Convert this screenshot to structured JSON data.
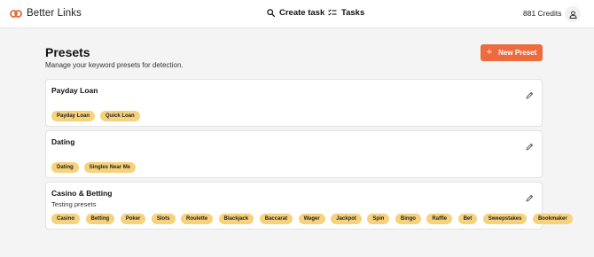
{
  "app": {
    "name": "Better Links",
    "brand_color": "#e8683c"
  },
  "nav": [
    {
      "label": "Create task",
      "icon": "search-icon"
    },
    {
      "label": "Tasks",
      "icon": "checklist-icon"
    }
  ],
  "account": {
    "credits": "881 Credits",
    "icon": "user-icon"
  },
  "page": {
    "title": "Presets",
    "subtitle": "Manage your keyword presets for detection.",
    "new_button": {
      "label": "New Preset",
      "icon": "plus-icon",
      "color": "#ec6b3f"
    }
  },
  "presets": [
    {
      "name": "Payday Loan",
      "description": "",
      "tags": [
        "Payday Loan",
        "Quick Loan"
      ]
    },
    {
      "name": "Dating",
      "description": "",
      "tags": [
        "Dating",
        "Singles Near Me"
      ]
    },
    {
      "name": "Casino & Betting",
      "description": "Testing presets",
      "tags": [
        "Casino",
        "Betting",
        "Poker",
        "Slots",
        "Roulette",
        "Blackjack",
        "Baccarat",
        "Wager",
        "Jackpot",
        "Spin",
        "Bingo",
        "Raffle",
        "Bet",
        "Sweepstakes",
        "Bookmaker"
      ]
    }
  ],
  "tag_color": "#f7d27d"
}
